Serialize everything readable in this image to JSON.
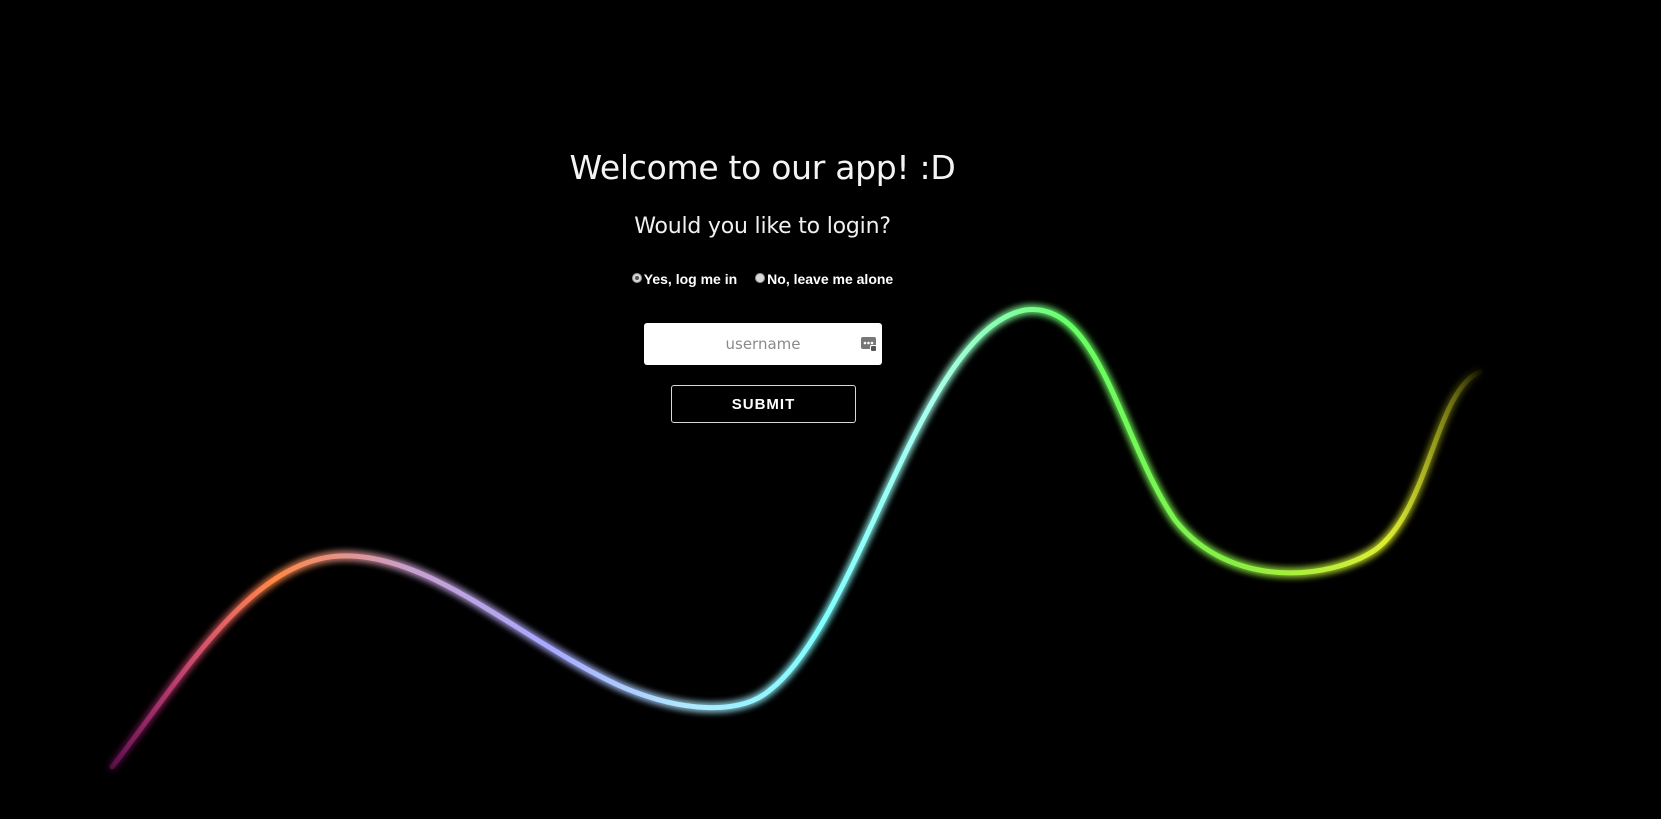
{
  "heading": {
    "title": "Welcome to our app! :D",
    "subtitle": "Would you like to login?"
  },
  "login_choice": {
    "options": [
      {
        "label": "Yes, log me in",
        "checked": true
      },
      {
        "label": "No, leave me alone",
        "checked": false
      }
    ]
  },
  "form": {
    "username_placeholder": "username",
    "username_value": "",
    "submit_label": "SUBMIT"
  },
  "background": {
    "description_colors": [
      "#ff33ff",
      "#ff8844",
      "#b0a8ff",
      "#b8ffff",
      "#66ff66",
      "#e0e040"
    ],
    "axis_color": "#ff66ff",
    "line_glow": true
  }
}
